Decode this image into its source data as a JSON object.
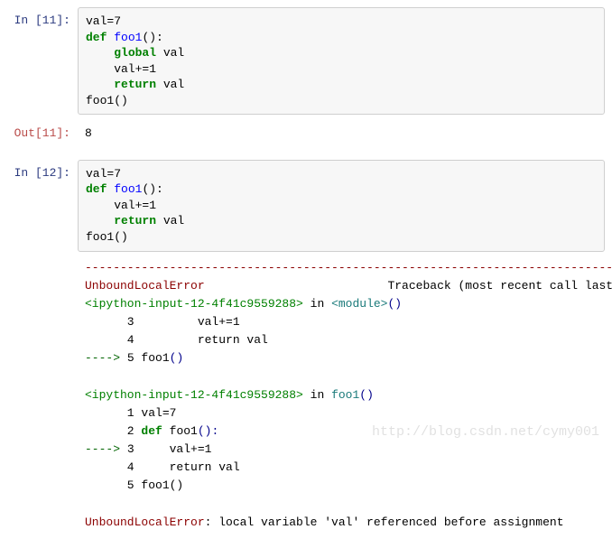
{
  "cell1": {
    "prompt": "In  [11]:",
    "code": {
      "l1a": "val",
      "l1b": "=",
      "l1c": "7",
      "l2a": "def",
      "l2b": " ",
      "l2c": "foo1",
      "l2d": "():",
      "l3a": "    ",
      "l3b": "global",
      "l3c": " val",
      "l4a": "    val",
      "l4b": "+=",
      "l4c": "1",
      "l5a": "    ",
      "l5b": "return",
      "l5c": " val",
      "l6": "foo1()"
    }
  },
  "out1": {
    "prompt": "Out[11]:",
    "value": "8"
  },
  "cell2": {
    "prompt": "In  [12]:",
    "code": {
      "l1a": "val",
      "l1b": "=",
      "l1c": "7",
      "l2a": "def",
      "l2b": " ",
      "l2c": "foo1",
      "l2d": "():",
      "l3a": "    val",
      "l3b": "+=",
      "l3c": "1",
      "l4a": "    ",
      "l4b": "return",
      "l4c": " val",
      "l5": "foo1()"
    }
  },
  "traceback": {
    "sep": "---------------------------------------------------------------------------",
    "ename": "UnboundLocalError",
    "header_rest": "                          Traceback (most recent call last)",
    "frame1": {
      "pre": "<ipython-input-12-4f41c9559288>",
      "in": " in ",
      "loc": "<module>",
      "paren": "()",
      "l3": "      3         val+=1",
      "l4": "      4         return val",
      "arrow": "----> ",
      "l5num": "5 ",
      "l5call": "foo1",
      "l5paren": "()"
    },
    "frame2": {
      "pre": "<ipython-input-12-4f41c9559288>",
      "in": " in ",
      "loc": "foo1",
      "paren": "()",
      "l1": "      1 val=7",
      "l2a": "      2 ",
      "l2b": "def ",
      "l2c": "foo1",
      "l2d": "():",
      "arrow": "----> ",
      "l3num": "3 ",
      "l3rest": "    val+=1",
      "l4": "      4     return val",
      "l5": "      5 foo1()"
    },
    "final_name": "UnboundLocalError",
    "final_msg": ": local variable 'val' referenced before assignment"
  },
  "watermark": "http://blog.csdn.net/cymy001"
}
